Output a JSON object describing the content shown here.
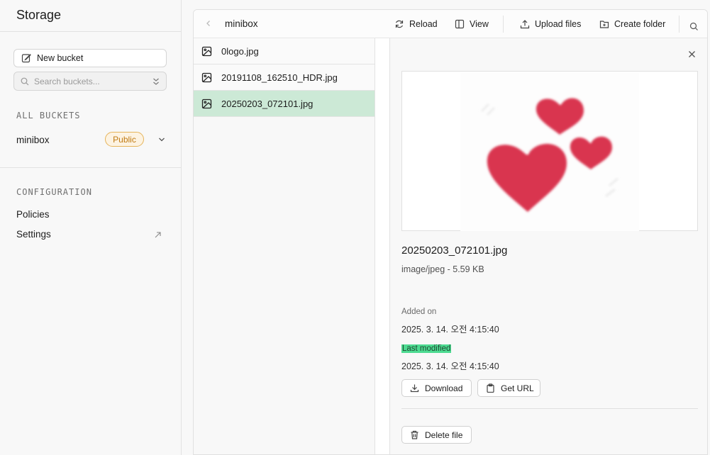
{
  "sidebar": {
    "title": "Storage",
    "new_bucket_label": "New bucket",
    "search_placeholder": "Search buckets...",
    "all_buckets_title": "ALL BUCKETS",
    "buckets": [
      {
        "name": "minibox",
        "badge": "Public"
      }
    ],
    "configuration_title": "CONFIGURATION",
    "config_items": [
      {
        "label": "Policies"
      },
      {
        "label": "Settings"
      }
    ]
  },
  "toolbar": {
    "bucket_title": "minibox",
    "reload_label": "Reload",
    "view_label": "View",
    "upload_label": "Upload files",
    "create_folder_label": "Create folder"
  },
  "files": [
    {
      "name": "0logo.jpg",
      "selected": false
    },
    {
      "name": "20191108_162510_HDR.jpg",
      "selected": false
    },
    {
      "name": "20250203_072101.jpg",
      "selected": true
    }
  ],
  "detail": {
    "file_name": "20250203_072101.jpg",
    "file_meta": "image/jpeg - 5.59 KB",
    "added_label": "Added on",
    "added_value": "2025. 3. 14. 오전 4:15:40",
    "modified_label": "Last modified",
    "modified_value": "2025. 3. 14. 오전 4:15:40",
    "download_label": "Download",
    "get_url_label": "Get URL",
    "delete_label": "Delete file"
  },
  "colors": {
    "selected_row": "#cce9d6",
    "public_badge_border": "#e6b45a",
    "public_badge_text": "#c07a12",
    "highlight": "#4ddb91",
    "heart": "#d9344f"
  }
}
